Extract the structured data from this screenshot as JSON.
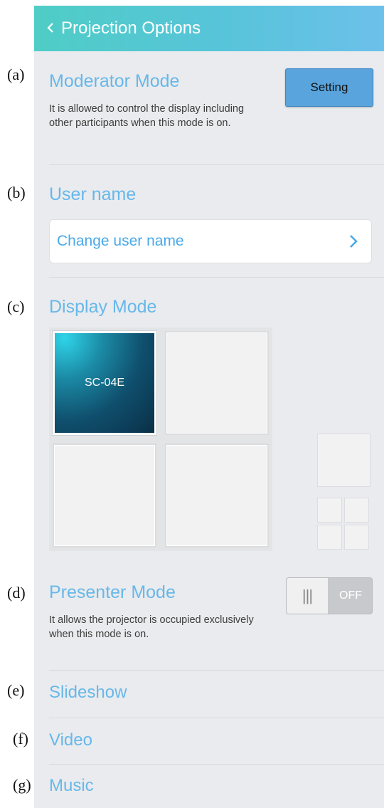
{
  "annotations": [
    "(a)",
    "(b)",
    "(c)",
    "(d)",
    "(e)",
    "(f)",
    "(g)"
  ],
  "header": {
    "title": "Projection Options",
    "back_icon": "chevron-left-icon"
  },
  "moderator": {
    "title": "Moderator Mode",
    "description": "It is allowed to control the display including other participants when this mode is on.",
    "button_label": "Setting"
  },
  "user_name": {
    "title": "User name",
    "row_label": "Change user name",
    "row_icon": "chevron-right-icon"
  },
  "display_mode": {
    "title": "Display Mode",
    "tiles": [
      {
        "label": "SC-04E",
        "active": true
      },
      {
        "label": "",
        "active": false
      },
      {
        "label": "",
        "active": false
      },
      {
        "label": "",
        "active": false
      }
    ],
    "layout_options": [
      "single-layout-icon",
      "quad-layout-icon"
    ]
  },
  "presenter": {
    "title": "Presenter Mode",
    "description": "It allows the projector is occupied exclusively when this mode is on.",
    "toggle_grip": "|||",
    "toggle_state": "OFF"
  },
  "menu": {
    "slideshow": "Slideshow",
    "video": "Video",
    "music": "Music"
  },
  "colors": {
    "accent": "#66b8ea",
    "header_start": "#4fcdc6",
    "header_end": "#6cc0ea",
    "button": "#5aa4dd"
  }
}
